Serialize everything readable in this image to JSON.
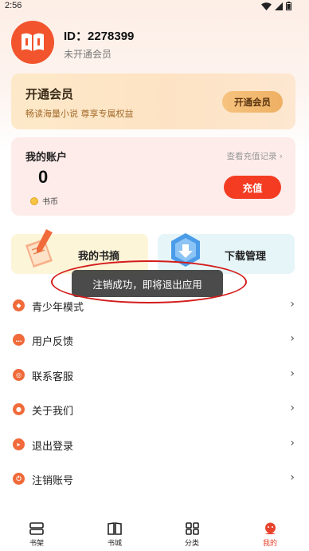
{
  "status_bar": {
    "time": "2:56"
  },
  "profile": {
    "user_id": "ID：2278399",
    "member_status": "未开通会员"
  },
  "vip_card": {
    "title": "开通会员",
    "subtitle": "畅读海量小说 尊享专属权益",
    "button_label": "开通会员"
  },
  "account": {
    "title": "我的账户",
    "balance": "0",
    "currency_label": "书币",
    "recharge_record_link": "查看充值记录 ›",
    "recharge_button": "充值"
  },
  "quick_actions": {
    "digest_label": "我的书摘",
    "download_label": "下载管理"
  },
  "toast": {
    "message": "注销成功，即将退出应用"
  },
  "menu": {
    "items": [
      {
        "label": "青少年模式",
        "icon": "youth-mode-icon"
      },
      {
        "label": "用户反馈",
        "icon": "feedback-icon"
      },
      {
        "label": "联系客服",
        "icon": "customer-service-icon"
      },
      {
        "label": "关于我们",
        "icon": "about-icon"
      },
      {
        "label": "退出登录",
        "icon": "logout-icon"
      },
      {
        "label": "注销账号",
        "icon": "deactivate-icon"
      }
    ]
  },
  "bottom_nav": {
    "items": [
      {
        "label": "书架",
        "icon": "bookshelf-icon"
      },
      {
        "label": "书城",
        "icon": "bookstore-icon"
      },
      {
        "label": "分类",
        "icon": "category-icon"
      },
      {
        "label": "我的",
        "icon": "profile-icon"
      }
    ],
    "active_color": "#e8432d"
  },
  "colors": {
    "accent": "#f43c22",
    "toast_bg": "#3c3c3c"
  }
}
